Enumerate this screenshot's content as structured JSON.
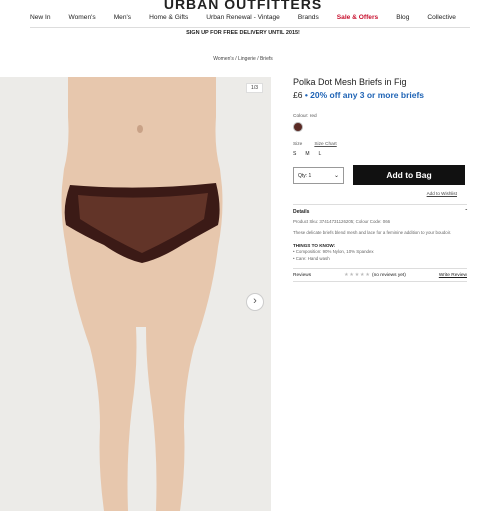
{
  "brand": {
    "logo": "URBAN OUTFITTERS"
  },
  "nav": [
    "New In",
    "Women's",
    "Men's",
    "Home & Gifts",
    "Urban Renewal - Vintage",
    "Brands",
    "Sale & Offers",
    "Blog",
    "Collective"
  ],
  "promo": "SIGN UP FOR FREE DELIVERY UNTIL 2015!",
  "breadcrumb": "Women's / Lingerie / Briefs",
  "gallery": {
    "counter": "1/3",
    "next_icon": "chevron-right-icon"
  },
  "product": {
    "title": "Polka Dot Mesh Briefs in Fig",
    "price": "£6",
    "offer": "• 20% off any 3 or more briefs",
    "colour_label": "Colour: red",
    "swatch_color": "#5a2a24",
    "size_label": "Size",
    "size_chart": "Size Chart",
    "sizes": [
      "S",
      "M",
      "L"
    ],
    "qty": "Qty: 1",
    "add_to_bag": "Add to Bag",
    "wishlist": "Add to Wishlist"
  },
  "details": {
    "heading": "Details",
    "codes": "Product Sku: 37414731126205; Colour Code: 066",
    "desc": "These delicate briefs blend mesh and lace for a feminine addition to your boudoir.",
    "things_heading": "THINGS TO KNOW:",
    "things": [
      "• Composition: 90% Nylon, 10% Spandex",
      "• Care: Hand wash"
    ]
  },
  "reviews": {
    "label": "Reviews",
    "count": "(no reviews yet)",
    "write": "Write Review"
  }
}
